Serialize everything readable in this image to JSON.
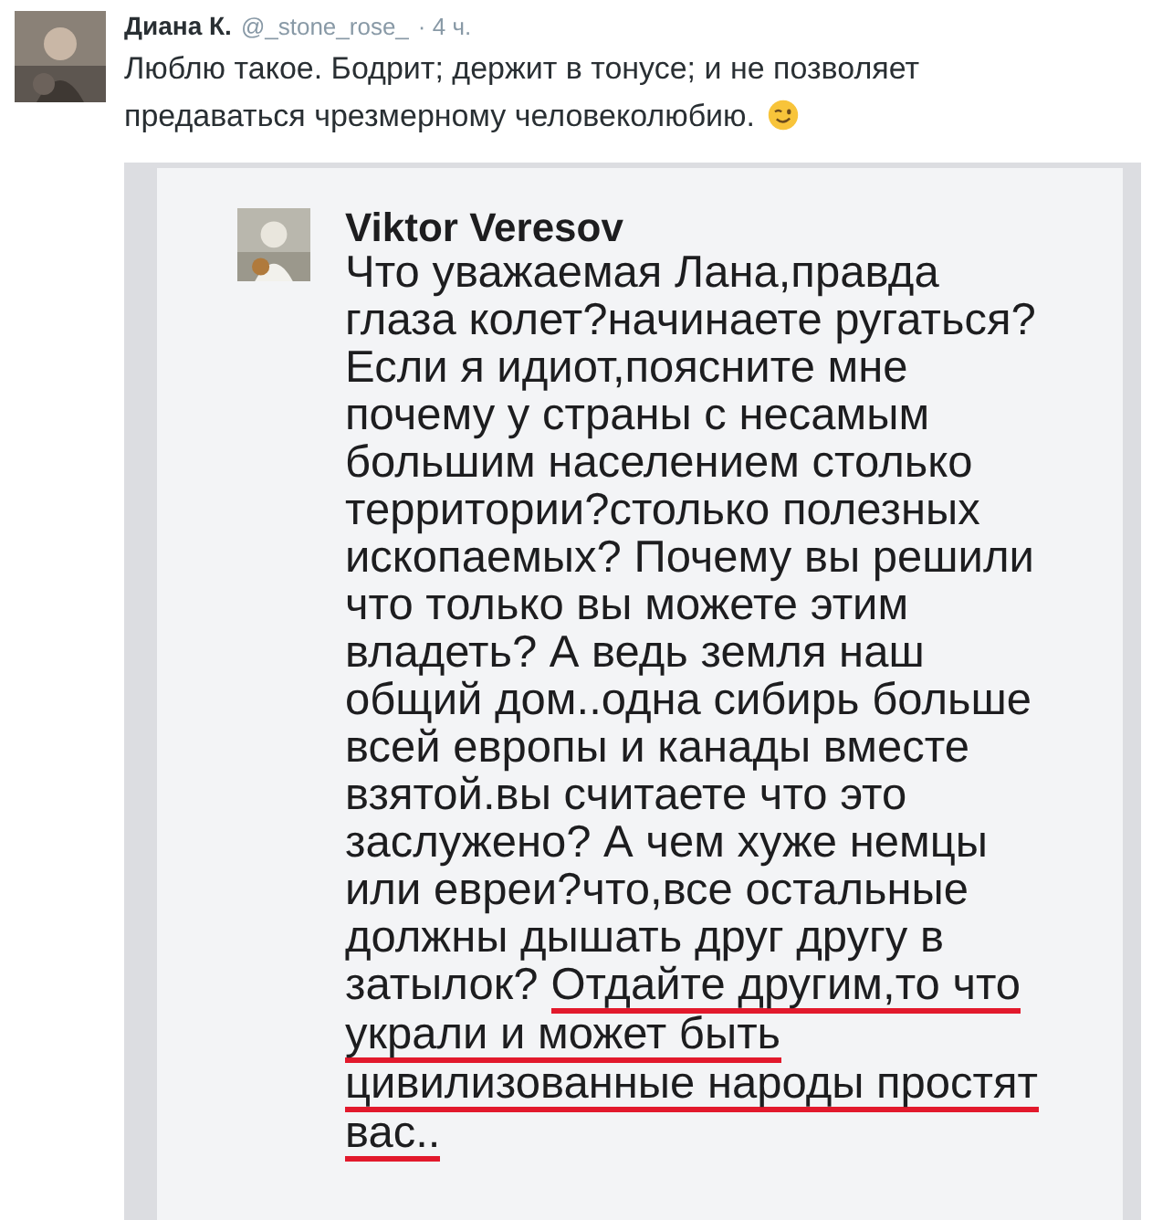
{
  "tweet": {
    "author": "Диана К.",
    "handle": "@_stone_rose_",
    "time": "· 4 ч.",
    "avatar": {
      "kind": "picture"
    },
    "text_lines": [
      "Люблю такое. Бодрит; держит в тонусе; и не позволяет",
      "предаваться чрезмерному человеколюбию."
    ],
    "emoji": {
      "kind": "wink"
    }
  },
  "attached_screenshot": {
    "comment": {
      "author": "Viktor Veresov",
      "avatar": {
        "kind": "picture"
      },
      "lines": [
        [
          {
            "text": "Что уважаемая Лана,правда",
            "underlined": false
          }
        ],
        [
          {
            "text": "глаза колет?начинаете ругаться?",
            "underlined": false
          }
        ],
        [
          {
            "text": "Если я идиот,поясните мне",
            "underlined": false
          }
        ],
        [
          {
            "text": "почему у страны с несамым",
            "underlined": false
          }
        ],
        [
          {
            "text": "большим населением столько",
            "underlined": false
          }
        ],
        [
          {
            "text": "территории?столько полезных",
            "underlined": false
          }
        ],
        [
          {
            "text": "ископаемых? Почему вы решили",
            "underlined": false
          }
        ],
        [
          {
            "text": "что только вы можете этим",
            "underlined": false
          }
        ],
        [
          {
            "text": "владеть? А ведь земля наш",
            "underlined": false
          }
        ],
        [
          {
            "text": "общий дом..одна сибирь больше",
            "underlined": false
          }
        ],
        [
          {
            "text": "всей европы и канады вместе",
            "underlined": false
          }
        ],
        [
          {
            "text": "взятой.вы считаете что это",
            "underlined": false
          }
        ],
        [
          {
            "text": "заслужено? А чем хуже немцы",
            "underlined": false
          }
        ],
        [
          {
            "text": "или евреи?что,все остальные",
            "underlined": false
          }
        ],
        [
          {
            "text": "должны дышать друг другу в",
            "underlined": false
          }
        ],
        [
          {
            "text": "затылок?",
            "underlined": false
          },
          {
            "text": "Отдайте другим,то что",
            "underlined": true
          }
        ],
        [
          {
            "text": "украли и может быть",
            "underlined": true
          }
        ],
        [
          {
            "text": "цивилизованные народы простят",
            "underlined": true
          }
        ],
        [
          {
            "text": "вас..",
            "underlined": true
          }
        ]
      ]
    }
  }
}
